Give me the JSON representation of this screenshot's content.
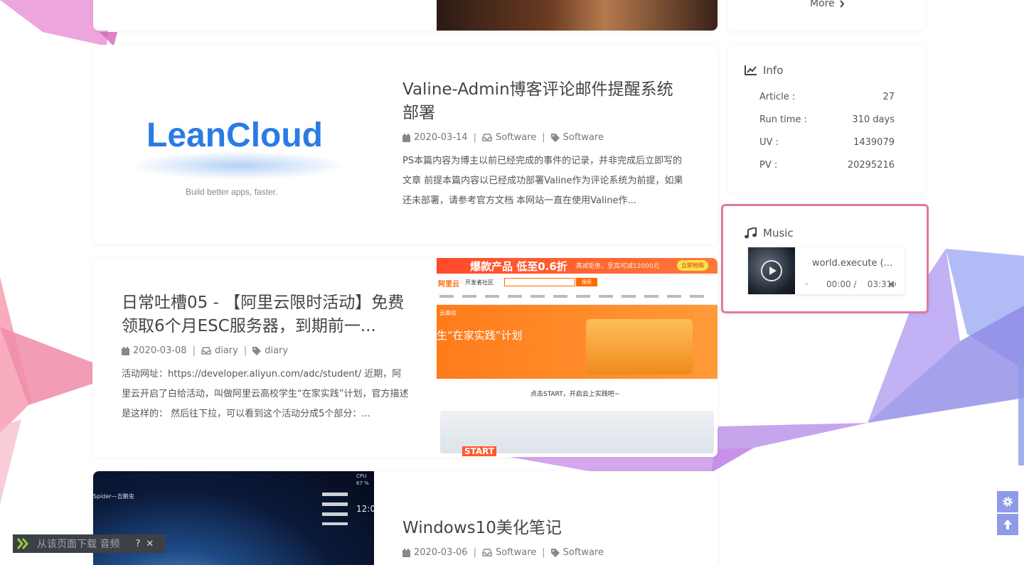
{
  "top_card": {
    "more_label": "More"
  },
  "posts": [
    {
      "title": "Valine-Admin博客评论邮件提醒系统部署",
      "date": "2020-03-14",
      "category": "Software",
      "tag": "Software",
      "excerpt": "PS本篇内容为博主以前已经完成的事件的记录，并非完成后立即写的文章 前提本篇内容以已经成功部署Valine作为评论系统为前提，如果还未部署，请参考官方文档 本网站一直在使用Valine作...",
      "thumb": {
        "logo_text": "LeanCloud",
        "tagline": "Build better apps, faster."
      }
    },
    {
      "title": "日常吐槽05 - 【阿里云限时活动】免费领取6个月ESC服务器，到期前一...",
      "date": "2020-03-08",
      "category": "diary",
      "tag": "diary",
      "excerpt": "活动网址：https://developer.aliyun.com/adc/student/ 近期，阿里云开启了白给活动，叫做阿里云高校学生“在家实践”计划，官方描述是这样的： 然后往下拉，可以看到这个活动分成5个部分：...",
      "thumb": {
        "banner_text": "爆款产品 低至0.6折",
        "banner_sub": "满减钜惠，至高可减12000元",
        "banner_btn": "立即抢购",
        "brand": "阿里云",
        "community": "开发者社区",
        "search_btn": "搜索",
        "hero_text": "生“在家实践”计划",
        "hero_tag": "云高校",
        "start_text": "点击START，开启云上实践吧~",
        "start_label": "START"
      }
    },
    {
      "title": "Windows10美化笔记",
      "date": "2020-03-06",
      "category": "Software",
      "tag": "Software",
      "thumb": {
        "caption": "Spider—吉鹏虫",
        "cpu_label": "CPU",
        "cpu_value": "67 %",
        "clock": "12:0"
      }
    }
  ],
  "info": {
    "title": "Info",
    "rows": [
      {
        "label": "Article :",
        "value": "27"
      },
      {
        "label": "Run time :",
        "value": "310 days"
      },
      {
        "label": "UV :",
        "value": "1439079"
      },
      {
        "label": "PV :",
        "value": "20295216"
      }
    ]
  },
  "music": {
    "title": "Music",
    "track": "world.execute (...",
    "dot": "-",
    "current": "00:00 /",
    "duration": "03:31"
  },
  "toast": {
    "text": "从该页面下载 音频",
    "help": "?",
    "close": "✕"
  },
  "colors": {
    "accent": "#8f9be8",
    "music_border": "#e0799c",
    "leancloud_blue": "#2b7be5",
    "aliyun_orange": "#ff6a00"
  }
}
